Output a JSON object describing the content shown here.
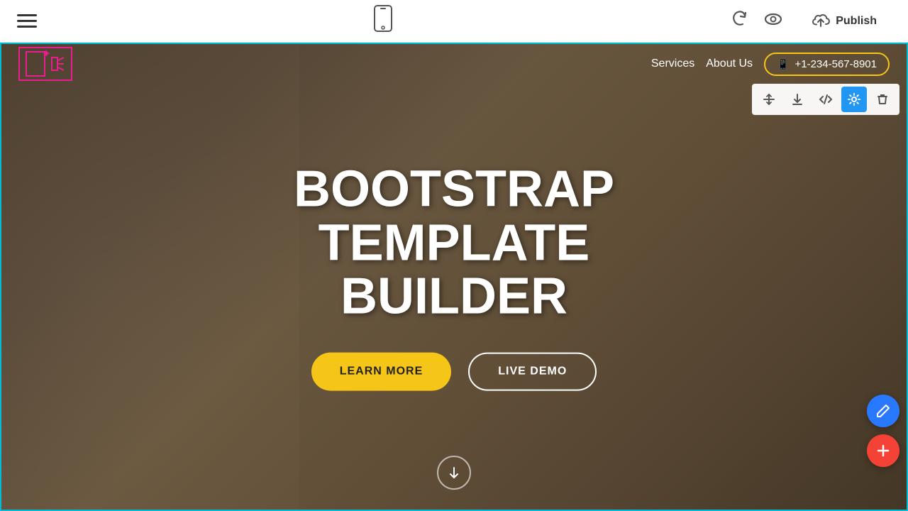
{
  "toolbar": {
    "publish_label": "Publish",
    "hamburger_aria": "Menu",
    "undo_aria": "Undo",
    "preview_aria": "Preview",
    "publish_aria": "Publish to cloud",
    "device_aria": "Mobile preview"
  },
  "site": {
    "nav_items": [
      {
        "label": "Services",
        "href": "#"
      },
      {
        "label": "About Us",
        "href": "#"
      }
    ],
    "phone": "+1-234-567-8901",
    "phone_icon": "📱"
  },
  "hero": {
    "title_line1": "BOOTSTRAP",
    "title_line2": "TEMPLATE BUILDER",
    "btn_primary": "LEARN MORE",
    "btn_secondary": "LIVE DEMO"
  },
  "section_tools": [
    {
      "icon": "↕",
      "label": "move",
      "active": false
    },
    {
      "icon": "⬇",
      "label": "download",
      "active": false
    },
    {
      "icon": "</>",
      "label": "code",
      "active": false
    },
    {
      "icon": "⚙",
      "label": "settings",
      "active": true
    },
    {
      "icon": "🗑",
      "label": "delete",
      "active": false
    }
  ],
  "float_buttons": {
    "edit_label": "Edit",
    "add_label": "Add"
  },
  "colors": {
    "accent_yellow": "#f5c518",
    "accent_pink": "#e91e8c",
    "accent_blue": "#2979ff",
    "accent_red": "#f44336",
    "accent_cyan": "#00bcd4",
    "settings_blue": "#2196f3"
  }
}
